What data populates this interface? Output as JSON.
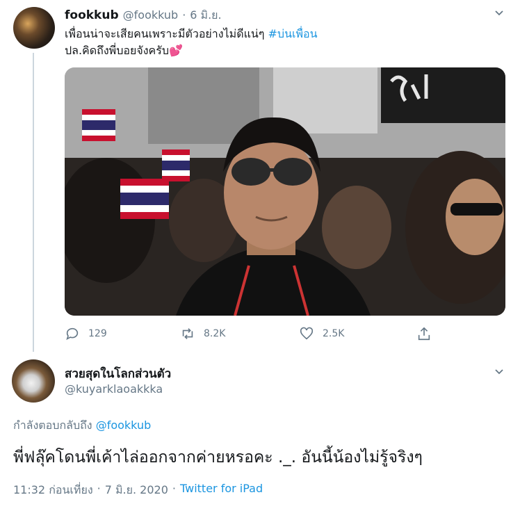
{
  "tweet": {
    "display_name": "fookkub",
    "handle": "@fookkub",
    "separator": "·",
    "date": "6 มิ.ย.",
    "line1": "เพื่อนน่าจะเสียคนเพราะมีตัวอย่างไม่ดีแน่ๆ",
    "hashtag": "#บ่นเพื่อน",
    "line2": "ปล.คิดถึงพี่บอยจังครับ",
    "emoji": "💕",
    "actions": {
      "replies": "129",
      "retweets": "8.2K",
      "likes": "2.5K"
    }
  },
  "reply": {
    "display_name": "สวยสุดในโลกส่วนตัว",
    "handle": "@kuyarklaoakkka",
    "replying_to_label": "กำลังตอบกลับถึง",
    "replying_to_handle": "@fookkub",
    "text": "พี่ฟลุ๊คโดนพี่เค้าไล่ออกจากค่ายหรอคะ ._. อันนี้น้องไม่รู้จริงๆ",
    "time": "11:32 ก่อนเที่ยง",
    "separator": "·",
    "date": "7 มิ.ย. 2020",
    "separator2": "·",
    "source": "Twitter for iPad"
  },
  "icons": {
    "chevron": "chevron-down-icon",
    "reply": "reply-icon",
    "retweet": "retweet-icon",
    "like": "heart-icon",
    "share": "share-icon"
  },
  "colors": {
    "link": "#1b95e0",
    "muted": "#657786",
    "text": "#14171a"
  }
}
